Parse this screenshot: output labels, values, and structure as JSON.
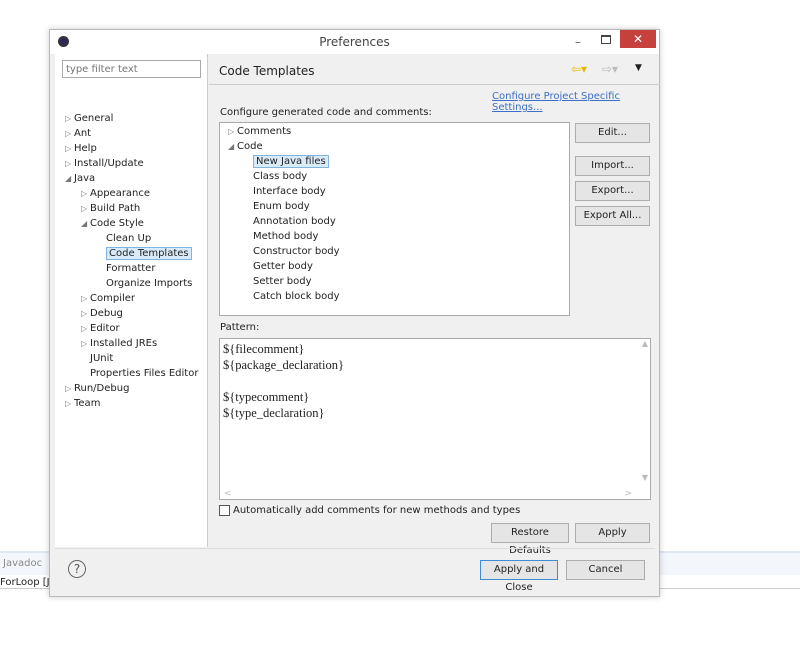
{
  "background": {
    "tab": "Javadoc",
    "item": "ForLoop [Ja"
  },
  "dialog": {
    "title": "Preferences",
    "filter_placeholder": "type filter text",
    "tree": [
      {
        "label": "General",
        "level": 0,
        "arrow": "collapsed"
      },
      {
        "label": "Ant",
        "level": 0,
        "arrow": "collapsed"
      },
      {
        "label": "Help",
        "level": 0,
        "arrow": "collapsed"
      },
      {
        "label": "Install/Update",
        "level": 0,
        "arrow": "collapsed"
      },
      {
        "label": "Java",
        "level": 0,
        "arrow": "expanded"
      },
      {
        "label": "Appearance",
        "level": 1,
        "arrow": "collapsed"
      },
      {
        "label": "Build Path",
        "level": 1,
        "arrow": "collapsed"
      },
      {
        "label": "Code Style",
        "level": 1,
        "arrow": "expanded"
      },
      {
        "label": "Clean Up",
        "level": 2,
        "arrow": ""
      },
      {
        "label": "Code Templates",
        "level": 2,
        "arrow": "",
        "selected": true
      },
      {
        "label": "Formatter",
        "level": 2,
        "arrow": ""
      },
      {
        "label": "Organize Imports",
        "level": 2,
        "arrow": ""
      },
      {
        "label": "Compiler",
        "level": 1,
        "arrow": "collapsed"
      },
      {
        "label": "Debug",
        "level": 1,
        "arrow": "collapsed"
      },
      {
        "label": "Editor",
        "level": 1,
        "arrow": "collapsed"
      },
      {
        "label": "Installed JREs",
        "level": 1,
        "arrow": "collapsed"
      },
      {
        "label": "JUnit",
        "level": 1,
        "arrow": ""
      },
      {
        "label": "Properties Files Editor",
        "level": 1,
        "arrow": ""
      },
      {
        "label": "Run/Debug",
        "level": 0,
        "arrow": "collapsed"
      },
      {
        "label": "Team",
        "level": 0,
        "arrow": "collapsed"
      }
    ],
    "page_title": "Code Templates",
    "project_link": "Configure Project Specific Settings...",
    "configure_label": "Configure generated code and comments:",
    "templates": [
      {
        "label": "Comments",
        "level": 0,
        "arrow": "collapsed"
      },
      {
        "label": "Code",
        "level": 0,
        "arrow": "expanded"
      },
      {
        "label": "New Java files",
        "level": 1,
        "selected": true
      },
      {
        "label": "Class body",
        "level": 1
      },
      {
        "label": "Interface body",
        "level": 1
      },
      {
        "label": "Enum body",
        "level": 1
      },
      {
        "label": "Annotation body",
        "level": 1
      },
      {
        "label": "Method body",
        "level": 1
      },
      {
        "label": "Constructor body",
        "level": 1
      },
      {
        "label": "Getter body",
        "level": 1
      },
      {
        "label": "Setter body",
        "level": 1
      },
      {
        "label": "Catch block body",
        "level": 1
      }
    ],
    "side_buttons": {
      "edit": "Edit...",
      "import": "Import...",
      "export": "Export...",
      "export_all": "Export All..."
    },
    "pattern_label": "Pattern:",
    "pattern_lines": [
      "${filecomment}",
      "${package_declaration}",
      "",
      "${typecomment}",
      "${type_declaration}"
    ],
    "auto_comments": {
      "label": "Automatically add comments for new methods and types",
      "checked": false
    },
    "restore_defaults": "Restore Defaults",
    "apply": "Apply",
    "apply_close": "Apply and Close",
    "cancel": "Cancel",
    "accent": "#3c8cd8",
    "close_color": "#c7413c"
  }
}
